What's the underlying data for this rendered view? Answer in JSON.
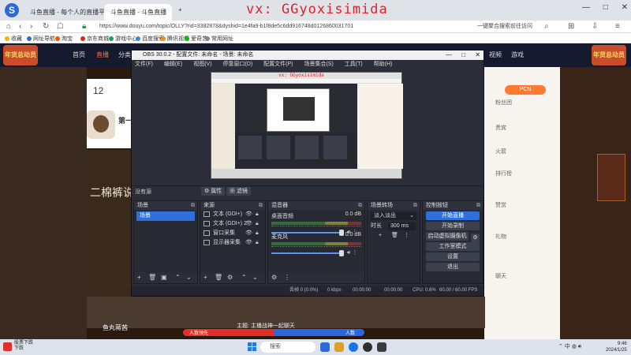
{
  "browser": {
    "tabs": [
      {
        "label": "斗鱼直播 - 每个人的直播平台",
        "active": false
      },
      {
        "label": "斗鱼直播 - 斗鱼直播",
        "active": true
      }
    ],
    "url": "https://www.douyu.com/topic/OLLY?rid=3382878&dyshid=1e4fa9-b1f8de5c6dd916748d0126860031701",
    "address_right": "一键聚合搜索前往访问",
    "bookmarks": [
      "收藏",
      "网址导航",
      "淘宝",
      "京东商城",
      "游戏中心",
      "百度搜索",
      "腾讯视频",
      "爱奇艺",
      "常用网址"
    ]
  },
  "watermark": "vx: GGyoxisimida",
  "site": {
    "banner_left": "年货总动员",
    "banner_right": "年货总动员",
    "nav": [
      "首页",
      "直播",
      "分类",
      "视频",
      "游戏"
    ],
    "room_number": "12",
    "anchor_title": "第一",
    "overlay_text": "二棉裤说",
    "pk_left": "人数领先",
    "pk_right": "人数",
    "topic": "主题: 主播战神一起聊天",
    "anchor_name": "鱼丸蒋茜",
    "right_panel": {
      "button": "PCN",
      "lines": [
        "粉丝团",
        "贵宾",
        "火箭",
        "排行榜",
        "赞赏",
        "礼物",
        "聊天"
      ]
    }
  },
  "obs": {
    "title": "OBS 30.0.2 - 配置文件: 未命名 - 场景: 未命名",
    "menu": [
      "文件(F)",
      "编辑(E)",
      "视图(V)",
      "停靠窗口(D)",
      "配置文件(P)",
      "场景集合(S)",
      "工具(T)",
      "帮助(H)"
    ],
    "toolbar": {
      "source_label": "没有源",
      "properties": "属性",
      "filters": "滤镜"
    },
    "scenes": {
      "title": "场景",
      "items": [
        "场景"
      ]
    },
    "sources": {
      "title": "来源",
      "items": [
        "文本 (GDI+)",
        "文本 (GDI+) 2",
        "窗口采集",
        "显示器采集"
      ]
    },
    "mixer": {
      "title": "混音器",
      "channels": [
        {
          "name": "桌面音频",
          "db": "0.0 dB"
        },
        {
          "name": "麦克风",
          "db": "0.0 dB"
        }
      ]
    },
    "transitions": {
      "title": "场景转场",
      "type": "淡入淡出",
      "duration_label": "时长",
      "duration": "300 ms"
    },
    "controls": {
      "title": "控制按钮",
      "buttons": [
        "开始直播",
        "开始录制",
        "启动虚拟摄像机",
        "工作室模式",
        "设置",
        "退出"
      ]
    },
    "status": {
      "dropped": "丢帧 0 (0.0%)",
      "live": "0 kbps",
      "live_time": "00:00:00",
      "rec_time": "00:00:00",
      "cpu": "CPU: 0.6%",
      "fps": "60.00 / 60.00 FPS"
    }
  },
  "taskbar": {
    "left_title": "股票下跌",
    "left_sub": "下跌",
    "search": "搜索",
    "time": "9:46",
    "date": "2024/1/25"
  }
}
